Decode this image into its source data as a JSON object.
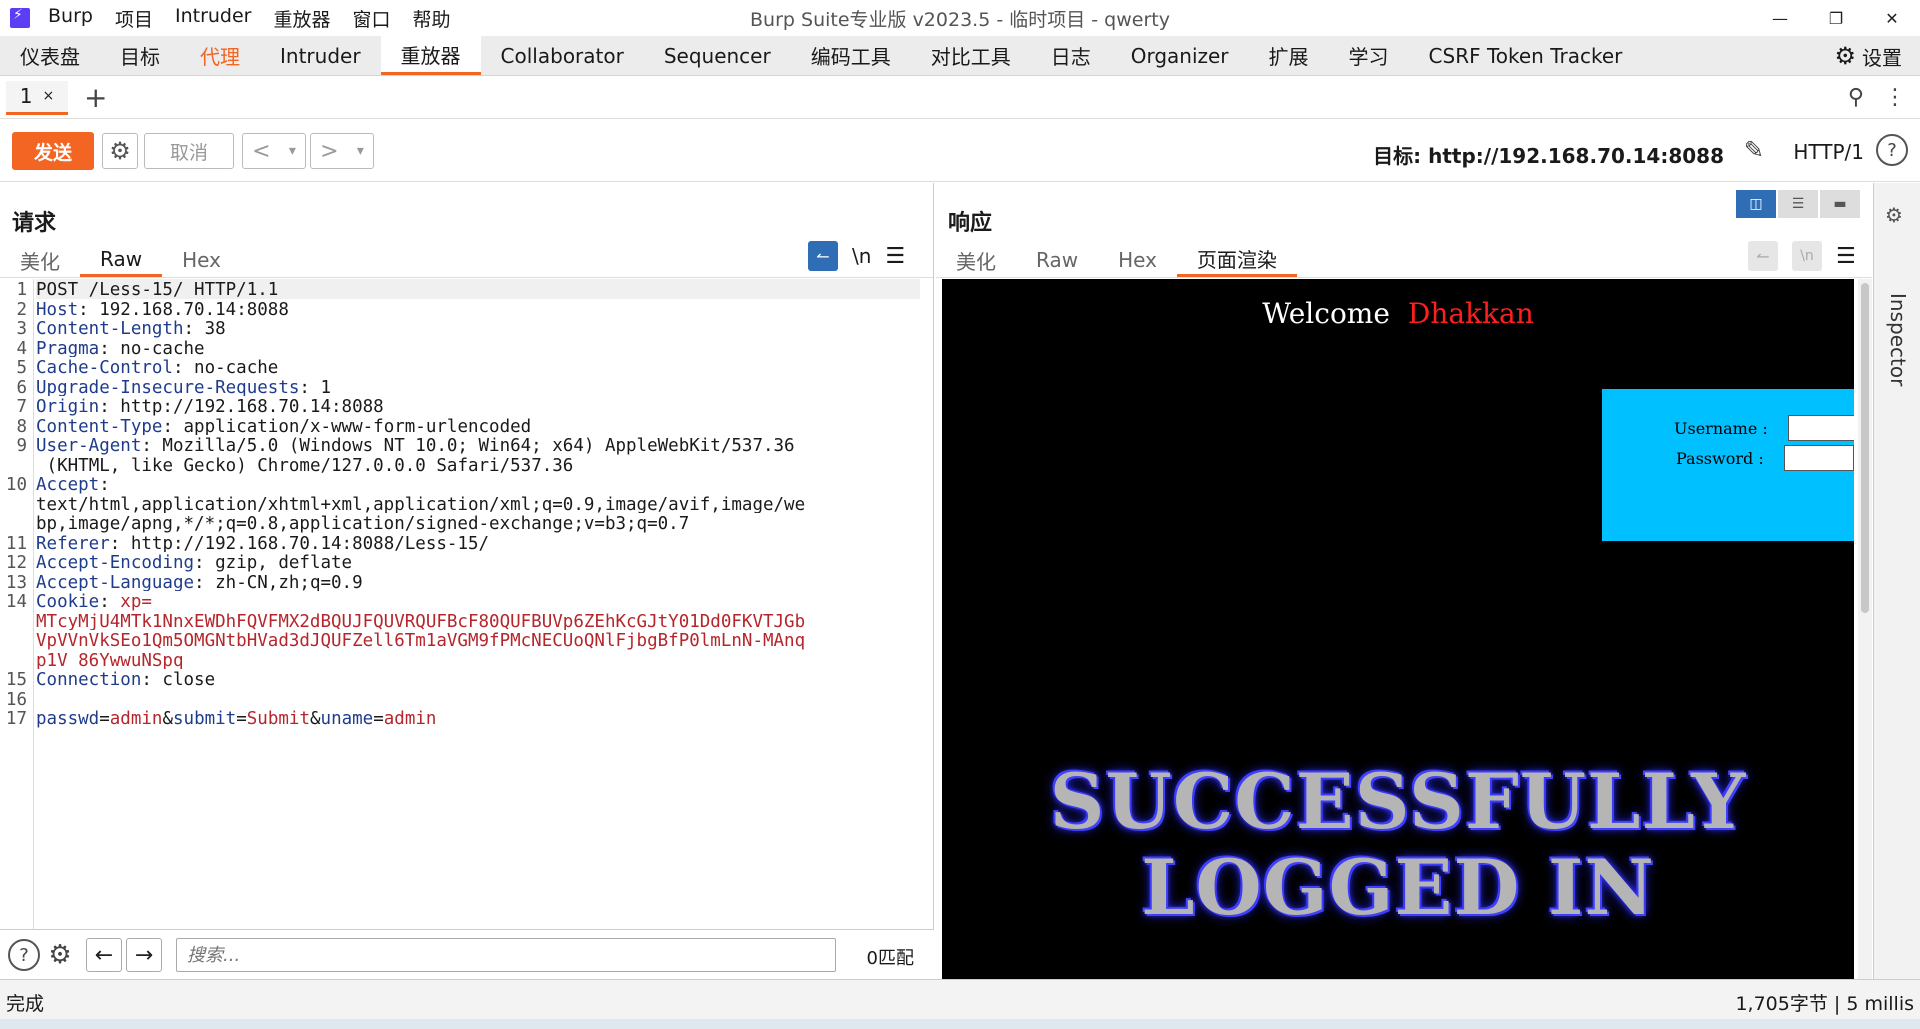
{
  "app": {
    "brand": "Burp",
    "menu": [
      "项目",
      "Intruder",
      "重放器",
      "窗口",
      "帮助"
    ],
    "window_title": "Burp Suite专业版  v2023.5 - 临时项目 - qwerty",
    "win_buttons": [
      "—",
      "❐",
      "✕"
    ]
  },
  "main_tabs": [
    {
      "label": "仪表盘",
      "state": "normal"
    },
    {
      "label": "目标",
      "state": "normal"
    },
    {
      "label": "代理",
      "state": "orange"
    },
    {
      "label": "Intruder",
      "state": "normal"
    },
    {
      "label": "重放器",
      "state": "active"
    },
    {
      "label": "Collaborator",
      "state": "normal"
    },
    {
      "label": "Sequencer",
      "state": "normal"
    },
    {
      "label": "编码工具",
      "state": "normal"
    },
    {
      "label": "对比工具",
      "state": "normal"
    },
    {
      "label": "日志",
      "state": "normal"
    },
    {
      "label": "Organizer",
      "state": "normal"
    },
    {
      "label": "扩展",
      "state": "normal"
    },
    {
      "label": "学习",
      "state": "normal"
    },
    {
      "label": "CSRF Token Tracker",
      "state": "normal"
    }
  ],
  "settings_label": "设置",
  "repeater_tab": {
    "label": "1",
    "close": "×",
    "add": "+"
  },
  "toolbar": {
    "send": "发送",
    "cancel": "取消",
    "back": "<",
    "forward": ">",
    "dropdown": "▾",
    "target_label": "目标: http://192.168.70.14:8088",
    "http_version": "HTTP/1",
    "help": "?"
  },
  "request": {
    "title": "请求",
    "tabs": [
      "美化",
      "Raw",
      "Hex"
    ],
    "active_tab": "Raw",
    "newline_toggle": "\\n",
    "line_numbers": [
      "1",
      "2",
      "3",
      "4",
      "5",
      "6",
      "7",
      "8",
      "9",
      "",
      "10",
      "",
      "",
      "11",
      "12",
      "13",
      "14",
      "",
      "",
      "",
      "15",
      "16",
      "17"
    ],
    "lines": [
      {
        "name": "",
        "value": "POST /Less-15/ HTTP/1.1"
      },
      {
        "name": "Host",
        "value": ": 192.168.70.14:8088"
      },
      {
        "name": "Content-Length",
        "value": ": 38"
      },
      {
        "name": "Pragma",
        "value": ": no-cache"
      },
      {
        "name": "Cache-Control",
        "value": ": no-cache"
      },
      {
        "name": "Upgrade-Insecure-Requests",
        "value": ": 1"
      },
      {
        "name": "Origin",
        "value": ": http://192.168.70.14:8088"
      },
      {
        "name": "Content-Type",
        "value": ": application/x-www-form-urlencoded"
      },
      {
        "name": "User-Agent",
        "value": ": Mozilla/5.0 (Windows NT 10.0; Win64; x64) AppleWebKit/537.36"
      },
      {
        "name": "",
        "value": " (KHTML, like Gecko) Chrome/127.0.0.0 Safari/537.36"
      },
      {
        "name": "Accept",
        "value": ":"
      },
      {
        "name": "",
        "value": "text/html,application/xhtml+xml,application/xml;q=0.9,image/avif,image/we"
      },
      {
        "name": "",
        "value": "bp,image/apng,*/*;q=0.8,application/signed-exchange;v=b3;q=0.7"
      },
      {
        "name": "Referer",
        "value": ": http://192.168.70.14:8088/Less-15/"
      },
      {
        "name": "Accept-Encoding",
        "value": ": gzip, deflate"
      },
      {
        "name": "Accept-Language",
        "value": ": zh-CN,zh;q=0.9"
      },
      {
        "name": "Cookie",
        "value": ": ",
        "cookie_name": "xp="
      },
      {
        "name": "",
        "red": "MTcyMjU4MTk1NnxEWDhFQVFMX2dBQUJFQUVRQUFBcF80QUFBUVp6ZEhKcGJtY01Dd0FKVTJGb"
      },
      {
        "name": "",
        "red": "VpVVnVkSEo1Qm5OMGNtbHVad3dJQUFZell6Tm1aVGM9fPMcNECUoQNlFjbgBfP0lmLnN-MAnq"
      },
      {
        "name": "",
        "red": "p1V_86YwwuNSpq"
      },
      {
        "name": "Connection",
        "value": ": close"
      },
      {
        "name": "",
        "value": ""
      },
      {
        "name": "",
        "body": true
      }
    ],
    "body": {
      "passwd_key": "passwd",
      "passwd_val": "admin",
      "submit_key": "submit",
      "submit_val": "Submit",
      "uname_key": "uname",
      "uname_val": "admin",
      "eq": "=",
      "amp": "&"
    }
  },
  "search": {
    "placeholder": "搜索...",
    "matches": "0匹配"
  },
  "response": {
    "title": "响应",
    "tabs": [
      "美化",
      "Raw",
      "Hex",
      "页面渲染"
    ],
    "active_tab": "页面渲染",
    "render": {
      "welcome": "Welcome",
      "name": "Dhakkan",
      "username_label": "Username :",
      "password_label": "Password :",
      "success_line1": "SUCCESSFULLY",
      "success_line2": "LOGGED IN"
    }
  },
  "inspector_label": "Inspector",
  "status": {
    "left": "完成",
    "right": "1,705字节 | 5 millis"
  },
  "colors": {
    "accent": "#f26522",
    "header_name": "#1f3c8c",
    "cookie_value": "#b5262c",
    "render_box": "#00c0ff",
    "name_red": "#ff1f1f"
  }
}
